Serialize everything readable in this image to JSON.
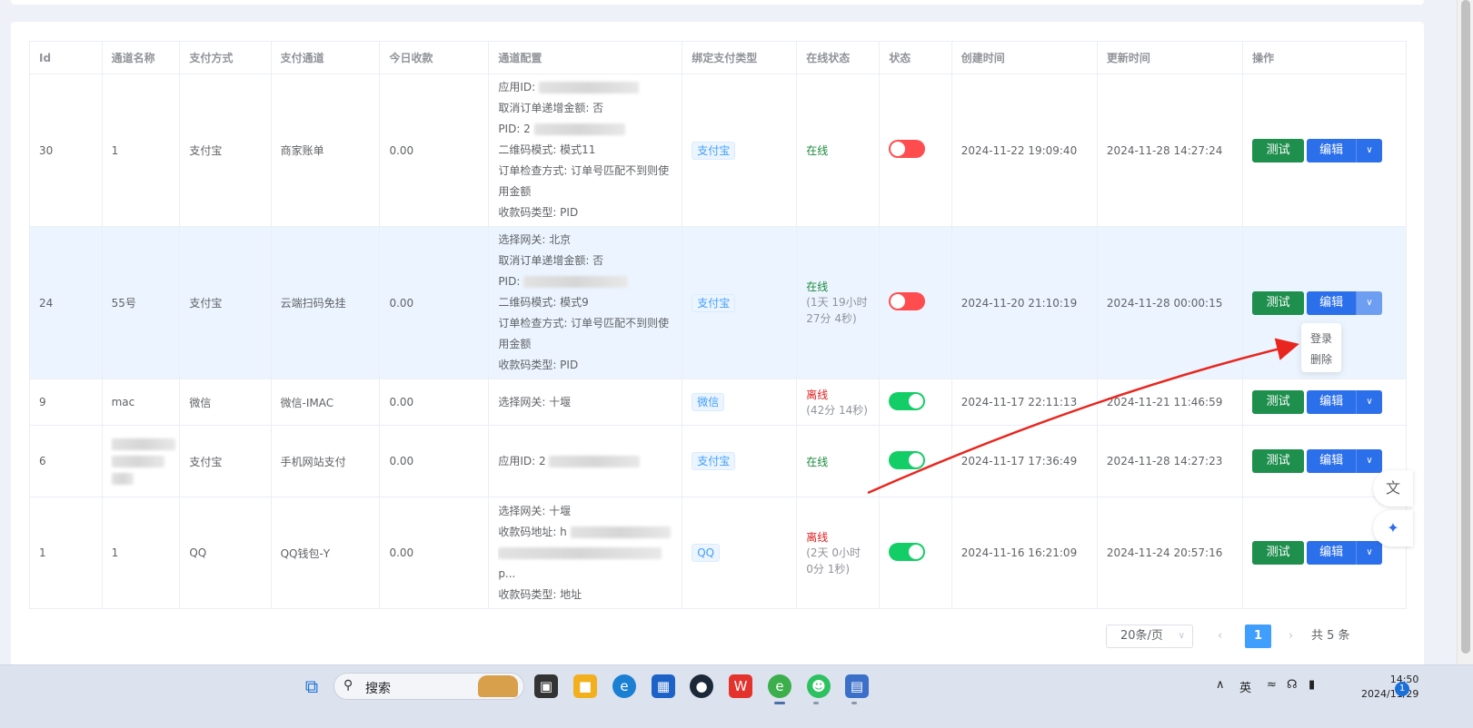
{
  "table": {
    "headers": [
      "Id",
      "通道名称",
      "支付方式",
      "支付通道",
      "今日收款",
      "通道配置",
      "绑定支付类型",
      "在线状态",
      "状态",
      "创建时间",
      "更新时间",
      "操作"
    ],
    "rows": [
      {
        "id": "30",
        "name": "1",
        "method": "支付宝",
        "channel": "商家账单",
        "today": "0.00",
        "config": [
          "应用ID:",
          "取消订单递增金额: 否",
          "PID: 2",
          "二维码模式: 模式11",
          "订单检查方式: 订单号匹配不到则使",
          "用金额",
          "收款码类型: PID"
        ],
        "bind_type": "支付宝",
        "online": "在线",
        "online_sub": "",
        "switch_on": false,
        "created": "2024-11-22 19:09:40",
        "updated": "2024-11-28 14:27:24"
      },
      {
        "id": "24",
        "name": "55号",
        "method": "支付宝",
        "channel": "云端扫码免挂",
        "today": "0.00",
        "config": [
          "选择网关: 北京",
          "取消订单递增金额: 否",
          "PID:",
          "二维码模式: 模式9",
          "订单检查方式: 订单号匹配不到则使",
          "用金额",
          "收款码类型: PID"
        ],
        "bind_type": "支付宝",
        "online": "在线",
        "online_sub": "(1天 19小时 27分 4秒)",
        "switch_on": false,
        "created": "2024-11-20 21:10:19",
        "updated": "2024-11-28 00:00:15"
      },
      {
        "id": "9",
        "name": "mac",
        "method": "微信",
        "channel": "微信-IMAC",
        "today": "0.00",
        "config": [
          "选择网关: 十堰"
        ],
        "bind_type": "微信",
        "online": "离线",
        "online_sub": "(42分 14秒)",
        "switch_on": true,
        "created": "2024-11-17 22:11:13",
        "updated": "2024-11-21 11:46:59"
      },
      {
        "id": "6",
        "name": "",
        "method": "支付宝",
        "channel": "手机网站支付",
        "today": "0.00",
        "config": [
          "应用ID: 2"
        ],
        "bind_type": "支付宝",
        "online": "在线",
        "online_sub": "",
        "switch_on": true,
        "created": "2024-11-17 17:36:49",
        "updated": "2024-11-28 14:27:23"
      },
      {
        "id": "1",
        "name": "1",
        "method": "QQ",
        "channel": "QQ钱包-Y",
        "today": "0.00",
        "config": [
          "选择网关: 十堰",
          "收款码地址: h",
          "",
          "p...",
          "收款码类型: 地址"
        ],
        "bind_type": "QQ",
        "online": "离线",
        "online_sub": "(2天 0小时 0分 1秒)",
        "switch_on": true,
        "created": "2024-11-16 16:21:09",
        "updated": "2024-11-24 20:57:16"
      }
    ],
    "actions": {
      "test": "测试",
      "edit": "编辑"
    }
  },
  "dropdown": {
    "items": [
      "登录",
      "删除"
    ]
  },
  "pagination": {
    "page_size": "20条/页",
    "current": "1",
    "total": "共 5 条"
  },
  "taskbar": {
    "search_label": "搜索",
    "ime": "英",
    "time": "14:50",
    "date": "2024/11/29",
    "notification_count": "1"
  },
  "colors": {
    "primary": "#409eff",
    "success": "#13ce66",
    "danger": "#ff4d4f",
    "edit_button": "#2b6fea",
    "test_button": "#1f8f4e"
  }
}
